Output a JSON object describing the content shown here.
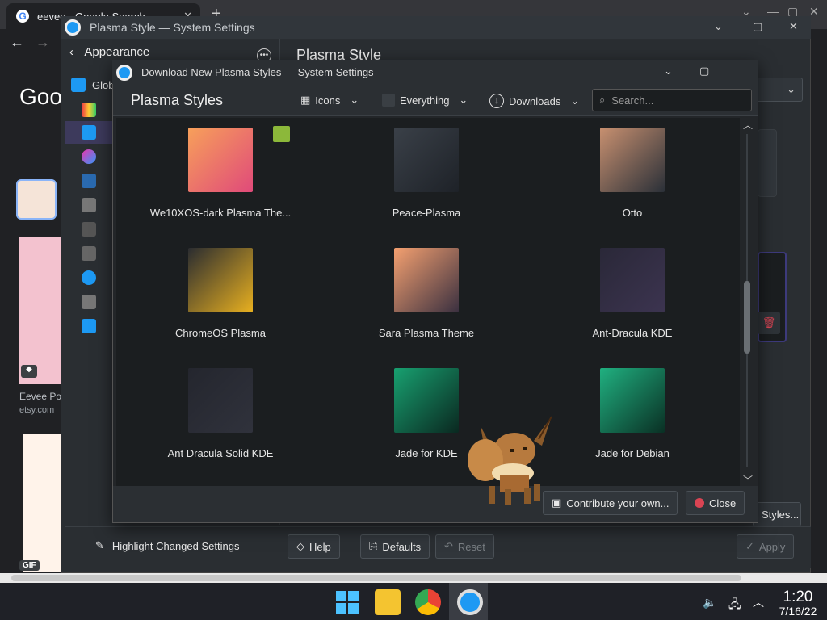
{
  "browser": {
    "tab_title": "eevee - Google Search",
    "new_tab": "+",
    "close_tab": "✕",
    "google_logo": "Goo",
    "result_caption": "Eevee Po",
    "result_source": "etsy.com",
    "gif_badge": "GIF"
  },
  "settings": {
    "window_title": "Plasma Style — System Settings",
    "sidebar_header": "Appearance",
    "sidebar_first_item": "Glob",
    "page_title": "Plasma Style",
    "get_new_partial": "Styles...",
    "footer": {
      "highlight": "Highlight Changed Settings",
      "help": "Help",
      "defaults": "Defaults",
      "reset": "Reset",
      "apply": "Apply"
    }
  },
  "dialog": {
    "window_title": "Download New Plasma Styles — System Settings",
    "heading": "Plasma Styles",
    "view_mode": "Icons",
    "filter": "Everything",
    "sort": "Downloads",
    "search_placeholder": "Search...",
    "items": [
      {
        "label": "We10XOS-dark Plasma The...",
        "c1": "#f7a05a",
        "c2": "#e04a7a"
      },
      {
        "label": "Peace-Plasma",
        "c1": "#3a4048",
        "c2": "#1e2228"
      },
      {
        "label": "Otto",
        "c1": "#c89070",
        "c2": "#2a3038"
      },
      {
        "label": "ChromeOS Plasma",
        "c1": "#2a2c30",
        "c2": "#e8b020"
      },
      {
        "label": "Sara Plasma Theme",
        "c1": "#f4a070",
        "c2": "#3a3040"
      },
      {
        "label": "Ant-Dracula KDE",
        "c1": "#2a2838",
        "c2": "#3c3450"
      },
      {
        "label": "Ant Dracula Solid KDE",
        "c1": "#24262e",
        "c2": "#30323c"
      },
      {
        "label": "Jade for KDE",
        "c1": "#18a070",
        "c2": "#0a2820"
      },
      {
        "label": "Jade for Debian",
        "c1": "#20b080",
        "c2": "#0a3024"
      }
    ],
    "contribute": "Contribute your own...",
    "close": "Close"
  },
  "taskbar": {
    "time": "1:20",
    "date": "7/16/22"
  }
}
